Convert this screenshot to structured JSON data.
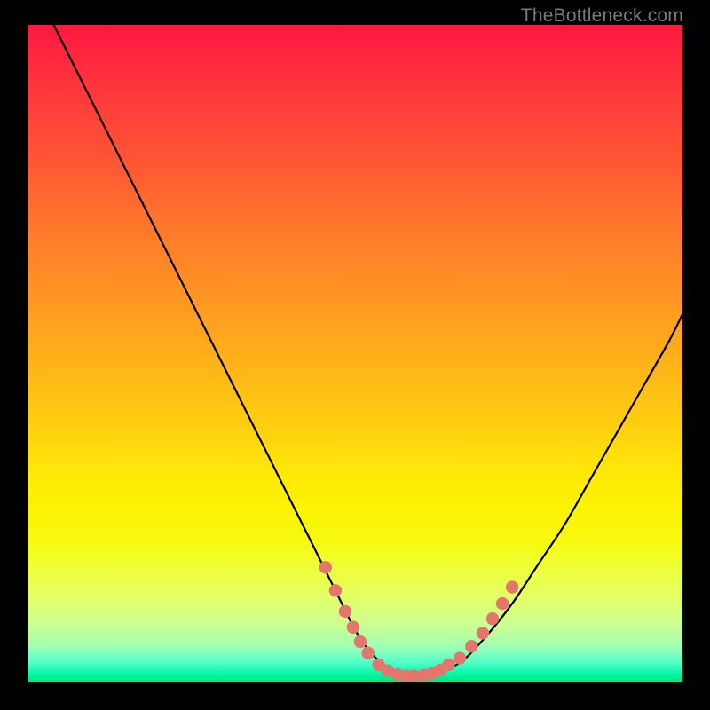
{
  "attribution": "TheBottleneck.com",
  "colors": {
    "background": "#000000",
    "curve": "#000000",
    "marker_fill": "#e4776d",
    "marker_stroke": "#c95a53"
  },
  "chart_data": {
    "type": "line",
    "title": "",
    "xlabel": "",
    "ylabel": "",
    "xlim": [
      0,
      100
    ],
    "ylim": [
      0,
      100
    ],
    "grid": false,
    "series": [
      {
        "name": "bottleneck-curve",
        "x": [
          4,
          8,
          12,
          16,
          20,
          24,
          28,
          32,
          36,
          40,
          44,
          48,
          50,
          52,
          54,
          56,
          58,
          60,
          62,
          66,
          70,
          74,
          78,
          82,
          86,
          90,
          94,
          98,
          100
        ],
        "y": [
          100,
          92,
          84,
          76,
          68,
          60,
          52,
          44,
          36,
          28,
          20,
          12,
          8,
          5,
          3,
          1.6,
          1,
          1,
          1.5,
          3,
          7,
          12,
          18,
          24,
          31,
          38,
          45,
          52,
          56
        ]
      }
    ],
    "markers": [
      {
        "name": "highlight-dots",
        "points_xy": [
          [
            45.5,
            17.5
          ],
          [
            47.0,
            14.0
          ],
          [
            48.5,
            10.8
          ],
          [
            49.7,
            8.4
          ],
          [
            50.8,
            6.2
          ],
          [
            52.0,
            4.5
          ],
          [
            53.6,
            2.7
          ],
          [
            55.0,
            1.8
          ],
          [
            56.5,
            1.2
          ],
          [
            57.8,
            1.0
          ],
          [
            59.0,
            1.0
          ],
          [
            60.5,
            1.1
          ],
          [
            61.8,
            1.4
          ],
          [
            63.0,
            1.9
          ],
          [
            64.3,
            2.7
          ],
          [
            66.0,
            3.7
          ],
          [
            67.8,
            5.5
          ],
          [
            69.5,
            7.5
          ],
          [
            71.0,
            9.7
          ],
          [
            72.5,
            12.0
          ],
          [
            74.0,
            14.5
          ]
        ]
      }
    ]
  }
}
